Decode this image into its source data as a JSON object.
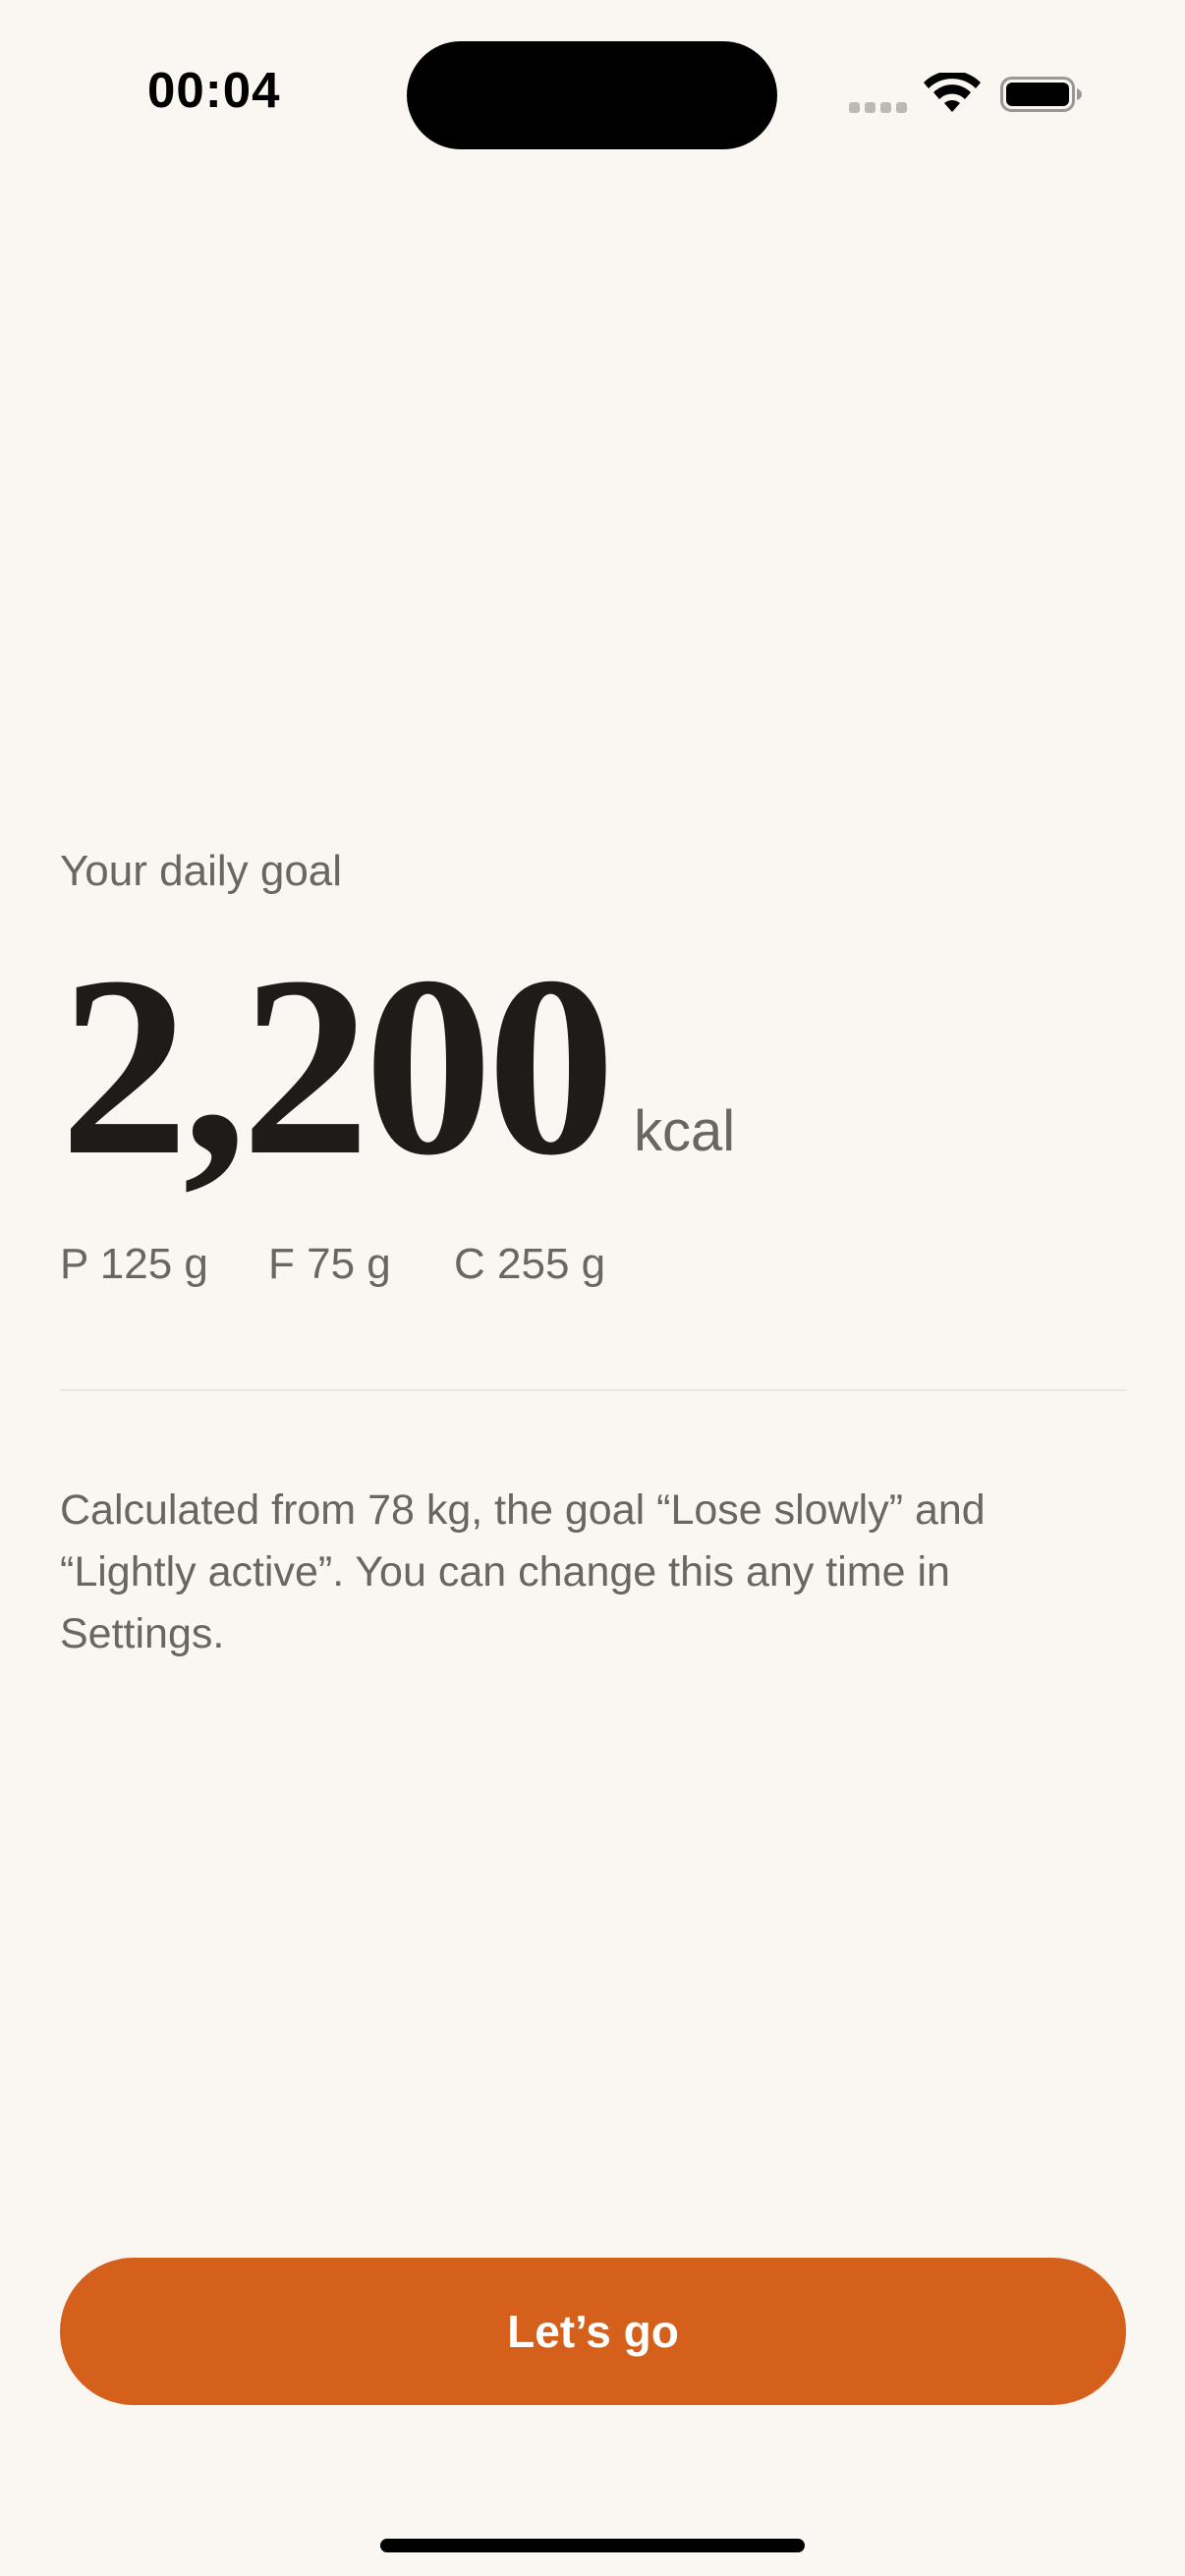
{
  "status_bar": {
    "time": "00:04",
    "icons": [
      "cellular-signal-icon",
      "wifi-icon",
      "battery-icon"
    ]
  },
  "goal": {
    "label": "Your daily goal",
    "value": "2,200",
    "unit": "kcal"
  },
  "macros": {
    "protein": "P 125 g",
    "fat": "F 75 g",
    "carbs": "C 255 g"
  },
  "explanation": "Calculated from 78 kg, the goal “Lose slowly” and “Lightly active”. You can change this any time in Settings.",
  "cta": {
    "label": "Let’s go"
  },
  "colors": {
    "background": "#faf7f2",
    "accent": "#d4601c",
    "text_primary": "#1e1b18",
    "text_secondary": "#6b6660"
  }
}
